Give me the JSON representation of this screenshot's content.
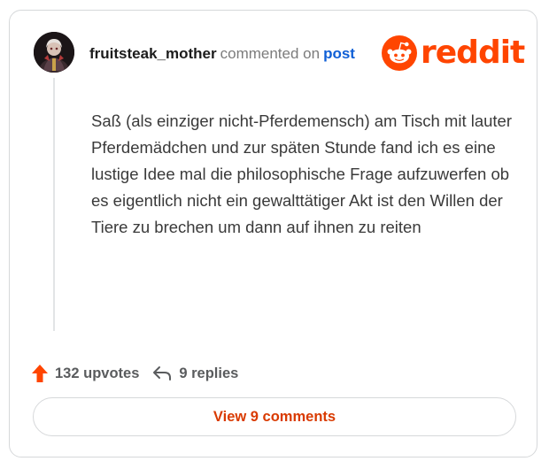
{
  "comment": {
    "username": "fruitsteak_mother",
    "action_text": "commented on",
    "post_link": "post",
    "body": "Saß (als einziger nicht-Pferdemensch) am Tisch mit lauter Pferdemädchen und zur späten Stunde fand ich es eine lustige Idee mal die philosophische Frage aufzuwerfen ob es eigentlich nicht ein gewalttätiger Akt ist den Willen der Tiere zu brechen um dann auf ihnen zu reiten"
  },
  "brand": {
    "logo_text": "reddit",
    "color": "#ff4500",
    "icon": "reddit-snoo-icon"
  },
  "footer": {
    "upvotes": "132 upvotes",
    "replies": "9 replies",
    "upvote_icon": "upvote-arrow-icon",
    "reply_icon": "reply-arrow-icon",
    "view_button": "View 9 comments"
  },
  "colors": {
    "accent": "#ff4500",
    "link": "#0f5fd6",
    "button_text": "#d93a00"
  }
}
